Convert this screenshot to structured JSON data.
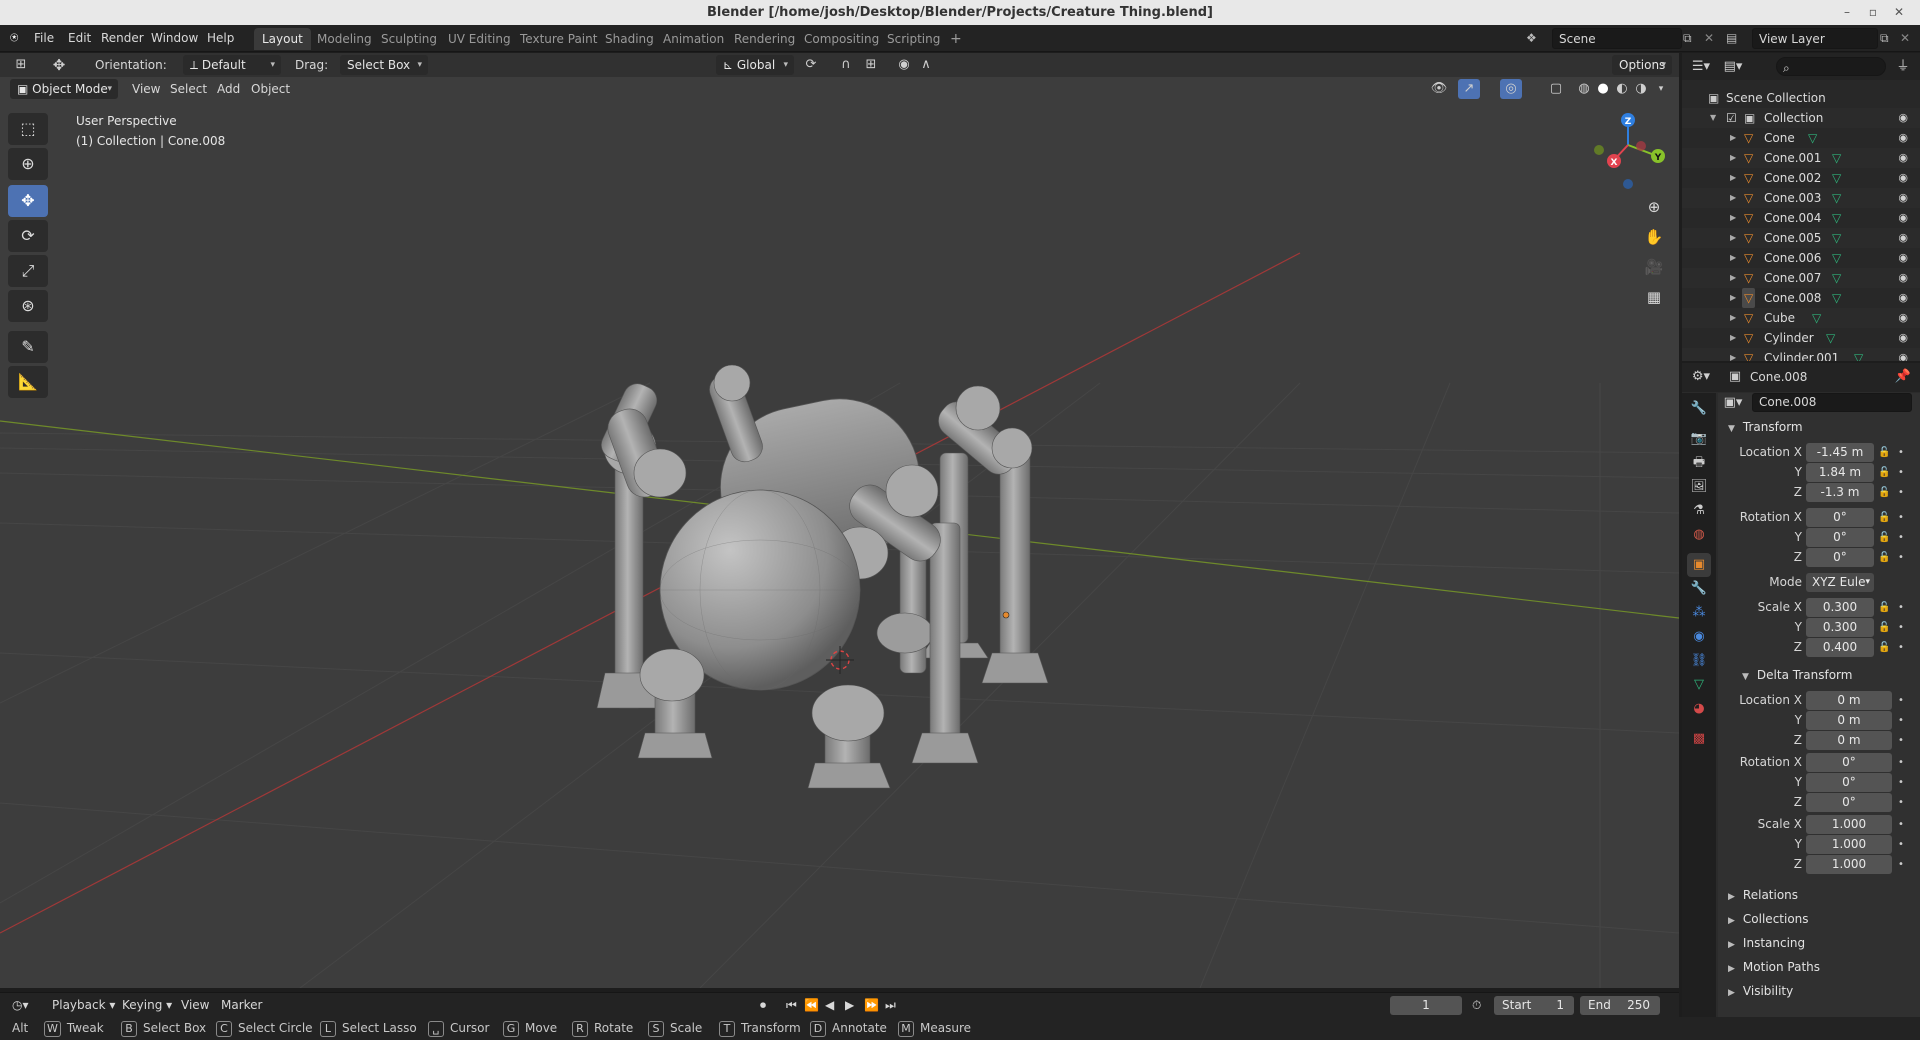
{
  "window": {
    "title": "Blender [/home/josh/Desktop/Blender/Projects/Creature Thing.blend]",
    "min": "–",
    "max": "▫",
    "close": "✕"
  },
  "menu": {
    "items": [
      "File",
      "Edit",
      "Render",
      "Window",
      "Help"
    ]
  },
  "workspaces": [
    "Layout",
    "Modeling",
    "Sculpting",
    "UV Editing",
    "Texture Paint",
    "Shading",
    "Animation",
    "Rendering",
    "Compositing",
    "Scripting"
  ],
  "workspace_add": "+",
  "scene": {
    "label": "Scene",
    "view_layer": "View Layer"
  },
  "tool_header": {
    "orientation_label": "Orientation:",
    "orientation_value": "Default",
    "drag_label": "Drag:",
    "drag_value": "Select Box",
    "transform_orientation": "Global",
    "options": "Options"
  },
  "viewport_header": {
    "mode": "Object Mode",
    "menus": [
      "View",
      "Select",
      "Add",
      "Object"
    ]
  },
  "viewport": {
    "perspective": "User Perspective",
    "collection_info": "(1) Collection | Cone.008",
    "gizmo": {
      "z": "Z",
      "y": "Y",
      "x": "X"
    }
  },
  "outliner": {
    "root": "Scene Collection",
    "collection": "Collection",
    "objects": [
      "Cone",
      "Cone.001",
      "Cone.002",
      "Cone.003",
      "Cone.004",
      "Cone.005",
      "Cone.006",
      "Cone.007",
      "Cone.008",
      "Cube",
      "Cylinder",
      "Cylinder.001"
    ],
    "selected": "Cone.008"
  },
  "properties": {
    "object_name": "Cone.008",
    "object_field": "Cone.008",
    "transform": {
      "title": "Transform",
      "location_label": "Location X",
      "location": [
        "-1.45 m",
        "1.84 m",
        "-1.3 m"
      ],
      "rotation_label": "Rotation X",
      "rotation": [
        "0°",
        "0°",
        "0°"
      ],
      "mode_label": "Mode",
      "mode": "XYZ Eule",
      "scale_label": "Scale X",
      "scale": [
        "0.300",
        "0.300",
        "0.400"
      ],
      "y": "Y",
      "z": "Z"
    },
    "delta": {
      "title": "Delta Transform",
      "location": [
        "0 m",
        "0 m",
        "0 m"
      ],
      "rotation": [
        "0°",
        "0°",
        "0°"
      ],
      "scale": [
        "1.000",
        "1.000",
        "1.000"
      ]
    },
    "sections": [
      "Relations",
      "Collections",
      "Instancing",
      "Motion Paths",
      "Visibility"
    ]
  },
  "timeline": {
    "menus": [
      "Playback",
      "Keying",
      "View",
      "Marker"
    ],
    "current_frame": "1",
    "start_label": "Start",
    "start": "1",
    "end_label": "End",
    "end": "250"
  },
  "statusbar": {
    "items": [
      {
        "key": "Alt",
        "label": ""
      },
      {
        "key": "W",
        "label": "Tweak"
      },
      {
        "key": "B",
        "label": "Select Box"
      },
      {
        "key": "C",
        "label": "Select Circle"
      },
      {
        "key": "L",
        "label": "Select Lasso"
      },
      {
        "key": "␣",
        "label": "Cursor"
      },
      {
        "key": "G",
        "label": "Move"
      },
      {
        "key": "R",
        "label": "Rotate"
      },
      {
        "key": "S",
        "label": "Scale"
      },
      {
        "key": "T",
        "label": "Transform"
      },
      {
        "key": "D",
        "label": "Annotate"
      },
      {
        "key": "M",
        "label": "Measure"
      }
    ]
  },
  "colors": {
    "accent": "#4d72b3",
    "x_axis": "#b33a3a",
    "y_axis": "#7a9a2a",
    "gizmo_x": "#e2434f",
    "gizmo_y": "#88c22a",
    "gizmo_z": "#2f7fe0",
    "object_orange": "#e68a2e",
    "mesh_green": "#2fb37a"
  }
}
